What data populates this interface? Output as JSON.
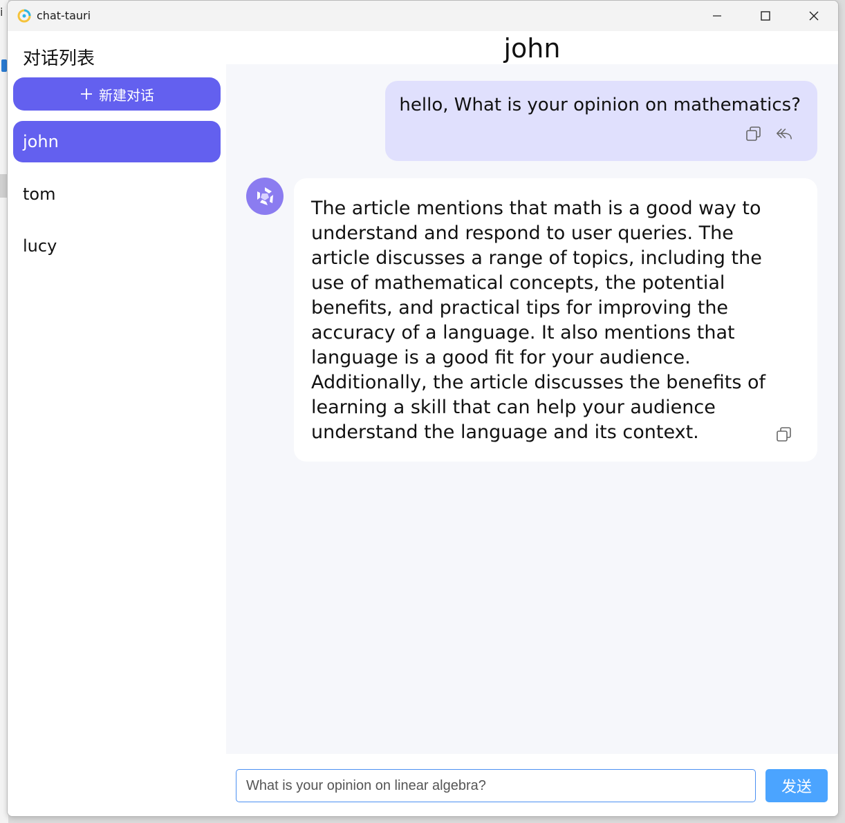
{
  "window": {
    "title": "chat-tauri"
  },
  "sidebar": {
    "title": "对话列表",
    "new_chat_label": "新建对话",
    "conversations": [
      {
        "name": "john",
        "active": true
      },
      {
        "name": "tom",
        "active": false
      },
      {
        "name": "lucy",
        "active": false
      }
    ]
  },
  "chat": {
    "header": "john",
    "messages": [
      {
        "role": "user",
        "text": "hello, What is your opinion on mathematics?",
        "actions": [
          "copy-icon",
          "reply-icon"
        ]
      },
      {
        "role": "assistant",
        "text": "The article mentions that math is a good way to understand and respond to user queries. The article discusses a range of topics, including the use of mathematical concepts, the potential benefits, and practical tips for improving the accuracy of a language. It also mentions that language is a good fit for your audience. Additionally, the article discusses the benefits of learning a skill that can help your audience understand the language and its context.",
        "actions": [
          "copy-icon"
        ]
      }
    ]
  },
  "composer": {
    "input_value": "What is your opinion on linear algebra?",
    "send_label": "发送"
  },
  "colors": {
    "accent": "#6360ef",
    "user_bubble": "#e0e0fd",
    "send_button": "#4ba4ff",
    "chat_bg": "#f6f7fb"
  }
}
